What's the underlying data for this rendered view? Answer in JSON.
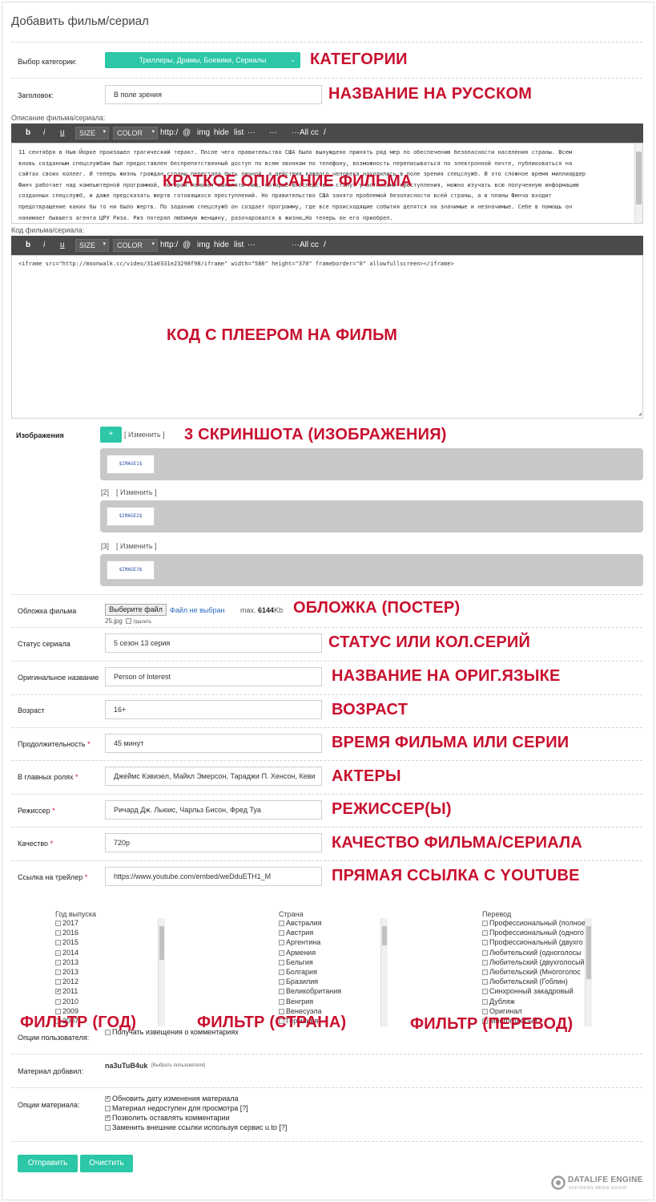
{
  "page": {
    "title": "Добавить фильм/сериал"
  },
  "category": {
    "label": "Выбор категории:",
    "value": "Триллеры, Драмы, Боевики, Сериалы",
    "note": "КАТЕГОРИИ"
  },
  "heading": {
    "label": "Заголовок:",
    "value": "В поле зрения",
    "note": "НАЗВАНИЕ НА РУССКОМ"
  },
  "toolbar": {
    "b": "b",
    "i": "i",
    "u": "u",
    "size": "SIZE",
    "color": "COLOR",
    "http": "http:/",
    "at": "@",
    "img": "img",
    "hide": "hide",
    "list": "list",
    "dots1": "···",
    "dots2": "···",
    "allcc": "···All cc",
    "slash": "/"
  },
  "description": {
    "label": "Описание фильма/сериала:",
    "lines": [
      "11 сентября в Нью-Йорке произошел трагический теракт. После чего правительство США было вынуждено принять ряд мер по обеспечению безопасности населения страны. Всем",
      "вновь созданным спецслужбам был предоставлен беспрепятственный доступ по всем звонкам по телефону, возможность переписываться по электронной почте, публиковаться на",
      "сайтах своих коллег. И теперь жизнь граждан страны перестала быть личной, а действия каждого человека находились в поле зрения спецслужб. В это сложное время миллиардер",
      "Финч работает над компьютерной программой, которая поможет выявлять лиц, которые впоследствии станут участниками преступления, можно изучать всю полученную информацию",
      "созданных спецслужб, и даже предсказать жертв готовящихся преступлений. Но правительство США занято проблемой безопасности всей страны, а в планы Финча входит",
      "предотвращение каких бы то ни было жертв. По заданию спецслужб он создает программу, где все происходящие события делятся на значимые и незначимые. Себе в помощь он",
      "нанимает бывшего агента ЦРУ Риза. Риз потерял любимую женщину, разочаровался в жизни…Но теперь он его приобрел."
    ],
    "note": "КРАТКОЕ ОПИСАНИЕ ФИЛЬМА"
  },
  "code": {
    "label": "Код фильма/сериала:",
    "value": "<iframe src=\"http://moonwalk.cc/video/31a0331e23298f98/iframe\" width=\"580\" height=\"370\" frameborder=\"0\" allowfullscreen></iframe>",
    "note": "КОД С ПЛЕЕРОМ НА ФИЛЬМ"
  },
  "images": {
    "label": "Изображения",
    "add": "+",
    "change": "[ Изменить ]",
    "note": "3 СКРИНШОТА (ИЗОБРАЖЕНИЯ)",
    "items": [
      {
        "num": "",
        "tag": "$IMAGE1$"
      },
      {
        "num": "[2]",
        "tag": "$IMAGE2$"
      },
      {
        "num": "[3]",
        "tag": "$IMAGE3$"
      }
    ]
  },
  "cover": {
    "label": "Обложка фильма",
    "choose": "Выберите файл",
    "nofile": "Файл не выбран",
    "max_prefix": "max.",
    "max_value": "6144",
    "max_unit": "Kb",
    "file": "25.jpg",
    "delete": "Удалить",
    "note": "ОБЛОЖКА (ПОСТЕР)"
  },
  "fields": [
    {
      "label": "Статус сериала",
      "required": false,
      "value": "5 сезон 13 серия",
      "note": "СТАТУС ИЛИ КОЛ.СЕРИЙ"
    },
    {
      "label": "Оригинальное название",
      "required": false,
      "value": "Person of Interest",
      "note": "НАЗВАНИЕ НА ОРИГ.ЯЗЫКЕ"
    },
    {
      "label": "Возраст",
      "required": false,
      "value": "16+",
      "note": "ВОЗРАСТ"
    },
    {
      "label": "Продолжительность",
      "required": true,
      "value": "45 минут",
      "note": "ВРЕМЯ ФИЛЬМА ИЛИ СЕРИИ"
    },
    {
      "label": "В главных ролях",
      "required": true,
      "value": "Джеймс Кэвизел, Майкл Эмерсон, Тараджи П. Хенсон, Кеви",
      "note": "АКТЕРЫ"
    },
    {
      "label": "Режиссер",
      "required": true,
      "value": "Ричард Дж. Льюис, Чарльз Бисон, Фред Туа",
      "note": "РЕЖИССЕР(Ы)"
    },
    {
      "label": "Качество",
      "required": true,
      "value": "720p",
      "note": "КАЧЕСТВО ФИЛЬМА/СЕРИАЛА"
    },
    {
      "label": "Ссылка на трейлер",
      "required": true,
      "value": "https://www.youtube.com/embed/weDduETH1_M",
      "note": "ПРЯМАЯ ССЫЛКА С YOUTUBE"
    }
  ],
  "filters": {
    "year": {
      "label": "Год выпуска",
      "note": "ФИЛЬТР (ГОД)",
      "options": [
        {
          "text": "2017",
          "checked": false
        },
        {
          "text": "2016",
          "checked": false
        },
        {
          "text": "2015",
          "checked": false
        },
        {
          "text": "2014",
          "checked": false
        },
        {
          "text": "2013",
          "checked": false
        },
        {
          "text": "2013",
          "checked": false
        },
        {
          "text": "2012",
          "checked": false
        },
        {
          "text": "2011",
          "checked": true
        },
        {
          "text": "2010",
          "checked": false
        },
        {
          "text": "2009",
          "checked": false
        },
        {
          "text": "2007",
          "checked": false
        }
      ]
    },
    "country": {
      "label": "Страна",
      "note": "ФИЛЬТР (СТРАНА)",
      "options": [
        {
          "text": "Австралия",
          "checked": false
        },
        {
          "text": "Австрия",
          "checked": false
        },
        {
          "text": "Аргентина",
          "checked": false
        },
        {
          "text": "Армения",
          "checked": false
        },
        {
          "text": "Бельгия",
          "checked": false
        },
        {
          "text": "Болгария",
          "checked": false
        },
        {
          "text": "Бразилия",
          "checked": false
        },
        {
          "text": "Великобритания",
          "checked": false
        },
        {
          "text": "Венгрия",
          "checked": false
        },
        {
          "text": "Венесуэла",
          "checked": false
        },
        {
          "text": "Германия",
          "checked": false
        }
      ]
    },
    "translation": {
      "label": "Перевод",
      "note": "ФИЛЬТР (ПЕРЕВОД)",
      "options": [
        {
          "text": "Профессиональный (полное",
          "checked": false
        },
        {
          "text": "Профессиональный (одного",
          "checked": false
        },
        {
          "text": "Профессиональный (двухго",
          "checked": false
        },
        {
          "text": "Любительский (одноголосы",
          "checked": false
        },
        {
          "text": "Любительский (двухголосый",
          "checked": false
        },
        {
          "text": "Любительский (Многоголос",
          "checked": false
        },
        {
          "text": "Любительский (Гоблин)",
          "checked": false
        },
        {
          "text": "Синхронный закадровый",
          "checked": false
        },
        {
          "text": "Дубляж",
          "checked": false
        },
        {
          "text": "Оригинал",
          "checked": false
        },
        {
          "text": "Многоголосый",
          "checked": false
        }
      ]
    }
  },
  "user_options": {
    "label": "Опции пользователя:",
    "notify": "Получать извещения о комментариях"
  },
  "added_by": {
    "label": "Материал добавил:",
    "user": "na3uTuB4uk",
    "choose": "[Выбрать пользователя]"
  },
  "material_options": {
    "label": "Опции материала:",
    "items": [
      {
        "text": "Обновить дату изменения материала",
        "checked": true
      },
      {
        "text": "Материал недоступен для просмотра [?]",
        "checked": false
      },
      {
        "text": "Позволить оставлять комментарии",
        "checked": true
      },
      {
        "text": "Заменить внешние ссылки используя сервис u.to [?]",
        "checked": false
      }
    ]
  },
  "buttons": {
    "submit": "Отправить",
    "clear": "Очистить"
  },
  "footer": {
    "brand": "DATALIFE ENGINE",
    "sub": "SOFTNEWS MEDIA GROUP"
  },
  "colors": {
    "accent": "#2bc7a6",
    "note_red": "#c8102e",
    "toolbar": "#4a4a4a",
    "image_panel": "#c8c8c8"
  }
}
